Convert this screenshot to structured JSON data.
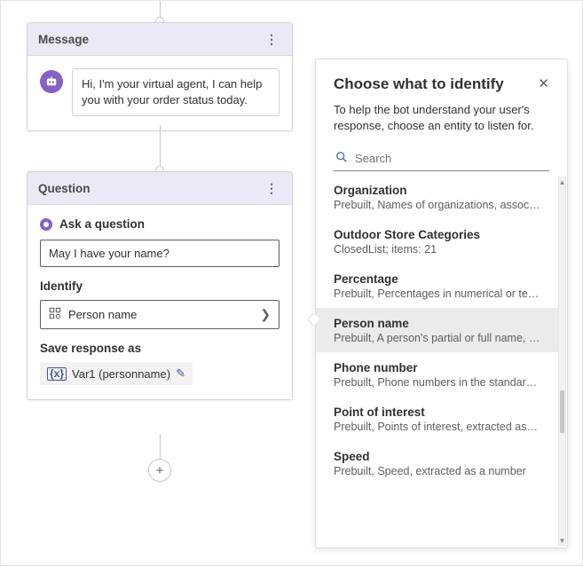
{
  "message_card": {
    "title": "Message",
    "bubble_text": "Hi, I'm your virtual agent, I can help you with your order status today."
  },
  "question_card": {
    "title": "Question",
    "lead": "Ask a question",
    "question_value": "May I have your name?",
    "identify_label": "Identify",
    "identify_value": "Person name",
    "save_label": "Save response as",
    "var_chip": "Var1 (personname)"
  },
  "panel": {
    "title": "Choose what to identify",
    "description": "To help the bot understand your user's response, choose an entity to listen for.",
    "search_placeholder": "Search",
    "entities": [
      {
        "name": "Organization",
        "sub": "Prebuilt, Names of organizations, associations...",
        "selected": false
      },
      {
        "name": "Outdoor Store Categories",
        "sub": "ClosedList; items: 21",
        "selected": false
      },
      {
        "name": "Percentage",
        "sub": "Prebuilt, Percentages in numerical or text for...",
        "selected": false
      },
      {
        "name": "Person name",
        "sub": "Prebuilt, A person's partial or full name, extra...",
        "selected": true
      },
      {
        "name": "Phone number",
        "sub": "Prebuilt, Phone numbers in the standard US f...",
        "selected": false
      },
      {
        "name": "Point of interest",
        "sub": "Prebuilt, Points of interest, extracted as a string",
        "selected": false
      },
      {
        "name": "Speed",
        "sub": "Prebuilt, Speed, extracted as a number",
        "selected": false
      }
    ]
  },
  "icons": {
    "add": "+"
  }
}
